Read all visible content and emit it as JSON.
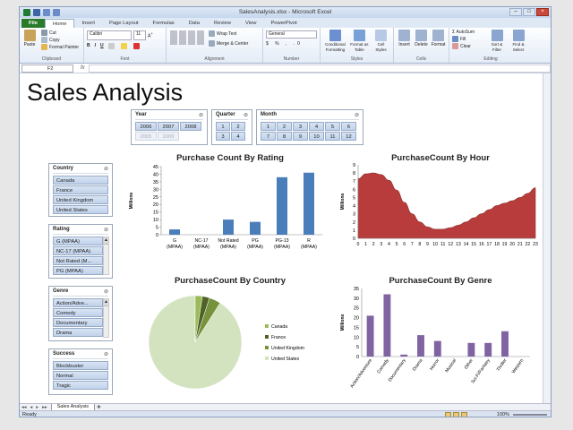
{
  "window": {
    "title": "SalesAnalysis.xlsx - Microsoft Excel"
  },
  "ribbon_tabs": [
    "File",
    "Home",
    "Insert",
    "Page Layout",
    "Formulas",
    "Data",
    "Review",
    "View",
    "PowerPivot"
  ],
  "ribbon": {
    "clipboard": {
      "paste": "Paste",
      "cut": "Cut",
      "copy": "Copy",
      "format_painter": "Format Painter",
      "label": "Clipboard"
    },
    "font": {
      "name": "Calibri",
      "size": "11",
      "label": "Font",
      "bold": "B",
      "italic": "I",
      "underline": "U"
    },
    "alignment": {
      "wrap": "Wrap Text",
      "merge": "Merge & Center",
      "label": "Alignment"
    },
    "number": {
      "format": "General",
      "label": "Number"
    },
    "styles": {
      "cond": "Conditional Formatting",
      "table": "Format as Table",
      "cell": "Cell Styles",
      "label": "Styles"
    },
    "cells": {
      "insert": "Insert",
      "delete": "Delete",
      "format": "Format",
      "label": "Cells"
    },
    "editing": {
      "autosum": "AutoSum",
      "fill": "Fill",
      "clear": "Clear",
      "sort": "Sort & Filter",
      "find": "Find & Select",
      "label": "Editing"
    }
  },
  "formula_bar": {
    "cell": "F2",
    "fx": "fx",
    "value": ""
  },
  "sheet": {
    "title": "Sales Analysis",
    "tab": "Sales Analysis",
    "status": "Ready",
    "zoom": "100%"
  },
  "slicers": {
    "year": {
      "title": "Year",
      "items": [
        "2006",
        "2007",
        "2008",
        "2005",
        "2009"
      ],
      "dim": [
        3,
        4
      ]
    },
    "quarter": {
      "title": "Quarter",
      "items": [
        "1",
        "2",
        "3",
        "4"
      ]
    },
    "month": {
      "title": "Month",
      "items": [
        "1",
        "2",
        "3",
        "4",
        "5",
        "6",
        "7",
        "8",
        "9",
        "10",
        "11",
        "12"
      ]
    },
    "country": {
      "title": "Country",
      "items": [
        "Canada",
        "France",
        "United Kingdom",
        "United States"
      ]
    },
    "rating": {
      "title": "Rating",
      "items": [
        "G (MPAA)",
        "NC-17 (MPAA)",
        "Not Rated (M...",
        "PG (MPAA)"
      ]
    },
    "genre": {
      "title": "Genre",
      "items": [
        "Action/Adve...",
        "Comedy",
        "Documentary",
        "Drama"
      ]
    },
    "success": {
      "title": "Success",
      "items": [
        "Blockbuster",
        "Normal",
        "Tragic"
      ]
    }
  },
  "colors": {
    "bar_blue": "#4a7ebb",
    "area_red": "#b83c3c",
    "purple": "#8064a2",
    "pie_light": "#d4e3bf",
    "pie_mid": "#9bbb59",
    "pie_dark": "#76923c",
    "pie_darkest": "#4f6228"
  },
  "chart_data": [
    {
      "type": "bar",
      "title": "Purchase Count By Rating",
      "ylabel": "Millions",
      "categories": [
        "G (MPAA)",
        "NC-17 (MPAA)",
        "Not Rated (MPAA)",
        "PG (MPAA)",
        "PG-13 (MPAA)",
        "R (MPAA)"
      ],
      "values": [
        3.5,
        0,
        10,
        8.5,
        38,
        41
      ],
      "ylim": [
        0,
        45
      ],
      "yticks": [
        0,
        5,
        10,
        15,
        20,
        25,
        30,
        35,
        40,
        45
      ]
    },
    {
      "type": "area",
      "title": "PurchaseCount By Hour",
      "ylabel": "Millions",
      "x": [
        0,
        1,
        2,
        3,
        4,
        5,
        6,
        7,
        8,
        9,
        10,
        11,
        12,
        13,
        14,
        15,
        16,
        17,
        18,
        19,
        20,
        21,
        22,
        23
      ],
      "values": [
        7.3,
        7.9,
        8.0,
        7.8,
        7.1,
        5.9,
        4.4,
        3.0,
        2.0,
        1.4,
        1.1,
        1.1,
        1.3,
        1.6,
        2.0,
        2.5,
        3.0,
        3.5,
        4.0,
        4.3,
        4.6,
        5.0,
        5.5,
        6.2
      ],
      "ylim": [
        0,
        9
      ],
      "yticks": [
        0,
        1,
        2,
        3,
        4,
        5,
        6,
        7,
        8,
        9
      ]
    },
    {
      "type": "pie",
      "title": "PurchaseCount By Country",
      "categories": [
        "Canada",
        "France",
        "United Kingdom",
        "United States"
      ],
      "values": [
        2.5,
        2.5,
        4,
        91
      ]
    },
    {
      "type": "bar",
      "title": "PurchaseCount By Genre",
      "ylabel": "Millions",
      "categories": [
        "Action/Adventure",
        "Comedy",
        "Documentary",
        "Drama",
        "Horror",
        "Musical",
        "Other",
        "Sci-Fi/Fantasy",
        "Thriller",
        "Western"
      ],
      "values": [
        21,
        32,
        1,
        11,
        8,
        0,
        7,
        7,
        13,
        0
      ],
      "ylim": [
        0,
        35
      ],
      "yticks": [
        0,
        5,
        10,
        15,
        20,
        25,
        30,
        35
      ]
    }
  ]
}
